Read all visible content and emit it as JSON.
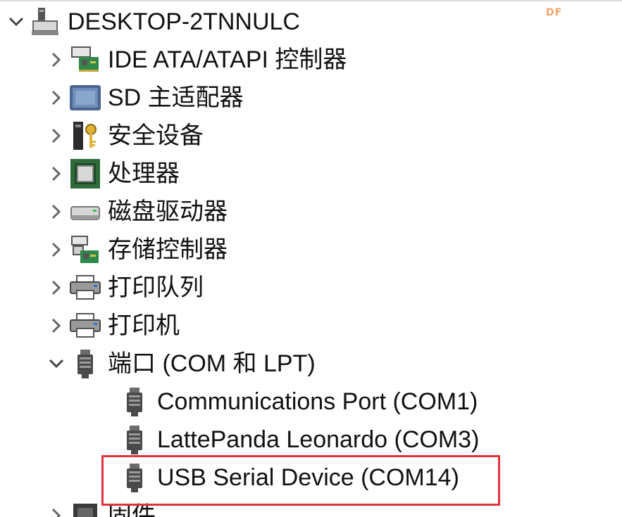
{
  "watermark": "DF",
  "tree": {
    "root": {
      "label": "DESKTOP-2TNNULC",
      "expanded": true,
      "icon": "computer-icon"
    },
    "categories": [
      {
        "key": "ide",
        "label": "IDE ATA/ATAPI 控制器",
        "expanded": false,
        "icon": "ide-controller-icon"
      },
      {
        "key": "sd",
        "label": "SD 主适配器",
        "expanded": false,
        "icon": "sd-host-adapter-icon"
      },
      {
        "key": "security",
        "label": "安全设备",
        "expanded": false,
        "icon": "security-device-icon"
      },
      {
        "key": "processor",
        "label": "处理器",
        "expanded": false,
        "icon": "processor-icon"
      },
      {
        "key": "disk",
        "label": "磁盘驱动器",
        "expanded": false,
        "icon": "disk-drive-icon"
      },
      {
        "key": "storage",
        "label": "存储控制器",
        "expanded": false,
        "icon": "storage-controller-icon"
      },
      {
        "key": "printqueue",
        "label": "打印队列",
        "expanded": false,
        "icon": "print-queue-icon"
      },
      {
        "key": "printer",
        "label": "打印机",
        "expanded": false,
        "icon": "printer-icon"
      },
      {
        "key": "ports",
        "label": "端口 (COM 和 LPT)",
        "expanded": true,
        "icon": "port-icon"
      }
    ],
    "ports_children": [
      {
        "label": "Communications Port (COM1)",
        "icon": "port-icon"
      },
      {
        "label": "LattePanda Leonardo (COM3)",
        "icon": "port-icon"
      },
      {
        "label": "USB Serial Device (COM14)",
        "icon": "port-icon",
        "highlighted": true
      }
    ],
    "partial_next": {
      "label": "固件",
      "icon": "firmware-icon"
    }
  },
  "colors": {
    "highlight": "#e0323c",
    "chevron": "#555555"
  }
}
